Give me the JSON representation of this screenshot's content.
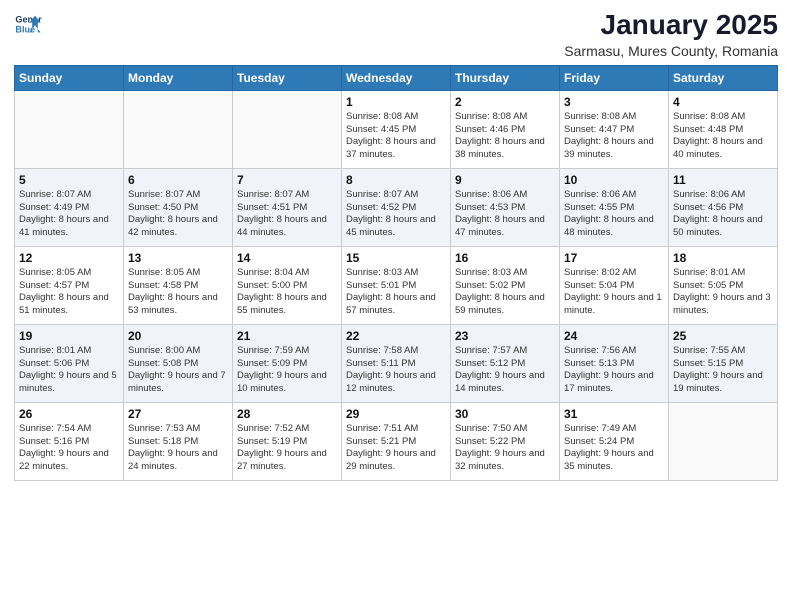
{
  "header": {
    "logo_line1": "General",
    "logo_line2": "Blue",
    "month": "January 2025",
    "location": "Sarmasu, Mures County, Romania"
  },
  "weekdays": [
    "Sunday",
    "Monday",
    "Tuesday",
    "Wednesday",
    "Thursday",
    "Friday",
    "Saturday"
  ],
  "weeks": [
    [
      {
        "day": "",
        "info": ""
      },
      {
        "day": "",
        "info": ""
      },
      {
        "day": "",
        "info": ""
      },
      {
        "day": "1",
        "info": "Sunrise: 8:08 AM\nSunset: 4:45 PM\nDaylight: 8 hours and 37 minutes."
      },
      {
        "day": "2",
        "info": "Sunrise: 8:08 AM\nSunset: 4:46 PM\nDaylight: 8 hours and 38 minutes."
      },
      {
        "day": "3",
        "info": "Sunrise: 8:08 AM\nSunset: 4:47 PM\nDaylight: 8 hours and 39 minutes."
      },
      {
        "day": "4",
        "info": "Sunrise: 8:08 AM\nSunset: 4:48 PM\nDaylight: 8 hours and 40 minutes."
      }
    ],
    [
      {
        "day": "5",
        "info": "Sunrise: 8:07 AM\nSunset: 4:49 PM\nDaylight: 8 hours and 41 minutes."
      },
      {
        "day": "6",
        "info": "Sunrise: 8:07 AM\nSunset: 4:50 PM\nDaylight: 8 hours and 42 minutes."
      },
      {
        "day": "7",
        "info": "Sunrise: 8:07 AM\nSunset: 4:51 PM\nDaylight: 8 hours and 44 minutes."
      },
      {
        "day": "8",
        "info": "Sunrise: 8:07 AM\nSunset: 4:52 PM\nDaylight: 8 hours and 45 minutes."
      },
      {
        "day": "9",
        "info": "Sunrise: 8:06 AM\nSunset: 4:53 PM\nDaylight: 8 hours and 47 minutes."
      },
      {
        "day": "10",
        "info": "Sunrise: 8:06 AM\nSunset: 4:55 PM\nDaylight: 8 hours and 48 minutes."
      },
      {
        "day": "11",
        "info": "Sunrise: 8:06 AM\nSunset: 4:56 PM\nDaylight: 8 hours and 50 minutes."
      }
    ],
    [
      {
        "day": "12",
        "info": "Sunrise: 8:05 AM\nSunset: 4:57 PM\nDaylight: 8 hours and 51 minutes."
      },
      {
        "day": "13",
        "info": "Sunrise: 8:05 AM\nSunset: 4:58 PM\nDaylight: 8 hours and 53 minutes."
      },
      {
        "day": "14",
        "info": "Sunrise: 8:04 AM\nSunset: 5:00 PM\nDaylight: 8 hours and 55 minutes."
      },
      {
        "day": "15",
        "info": "Sunrise: 8:03 AM\nSunset: 5:01 PM\nDaylight: 8 hours and 57 minutes."
      },
      {
        "day": "16",
        "info": "Sunrise: 8:03 AM\nSunset: 5:02 PM\nDaylight: 8 hours and 59 minutes."
      },
      {
        "day": "17",
        "info": "Sunrise: 8:02 AM\nSunset: 5:04 PM\nDaylight: 9 hours and 1 minute."
      },
      {
        "day": "18",
        "info": "Sunrise: 8:01 AM\nSunset: 5:05 PM\nDaylight: 9 hours and 3 minutes."
      }
    ],
    [
      {
        "day": "19",
        "info": "Sunrise: 8:01 AM\nSunset: 5:06 PM\nDaylight: 9 hours and 5 minutes."
      },
      {
        "day": "20",
        "info": "Sunrise: 8:00 AM\nSunset: 5:08 PM\nDaylight: 9 hours and 7 minutes."
      },
      {
        "day": "21",
        "info": "Sunrise: 7:59 AM\nSunset: 5:09 PM\nDaylight: 9 hours and 10 minutes."
      },
      {
        "day": "22",
        "info": "Sunrise: 7:58 AM\nSunset: 5:11 PM\nDaylight: 9 hours and 12 minutes."
      },
      {
        "day": "23",
        "info": "Sunrise: 7:57 AM\nSunset: 5:12 PM\nDaylight: 9 hours and 14 minutes."
      },
      {
        "day": "24",
        "info": "Sunrise: 7:56 AM\nSunset: 5:13 PM\nDaylight: 9 hours and 17 minutes."
      },
      {
        "day": "25",
        "info": "Sunrise: 7:55 AM\nSunset: 5:15 PM\nDaylight: 9 hours and 19 minutes."
      }
    ],
    [
      {
        "day": "26",
        "info": "Sunrise: 7:54 AM\nSunset: 5:16 PM\nDaylight: 9 hours and 22 minutes."
      },
      {
        "day": "27",
        "info": "Sunrise: 7:53 AM\nSunset: 5:18 PM\nDaylight: 9 hours and 24 minutes."
      },
      {
        "day": "28",
        "info": "Sunrise: 7:52 AM\nSunset: 5:19 PM\nDaylight: 9 hours and 27 minutes."
      },
      {
        "day": "29",
        "info": "Sunrise: 7:51 AM\nSunset: 5:21 PM\nDaylight: 9 hours and 29 minutes."
      },
      {
        "day": "30",
        "info": "Sunrise: 7:50 AM\nSunset: 5:22 PM\nDaylight: 9 hours and 32 minutes."
      },
      {
        "day": "31",
        "info": "Sunrise: 7:49 AM\nSunset: 5:24 PM\nDaylight: 9 hours and 35 minutes."
      },
      {
        "day": "",
        "info": ""
      }
    ]
  ]
}
